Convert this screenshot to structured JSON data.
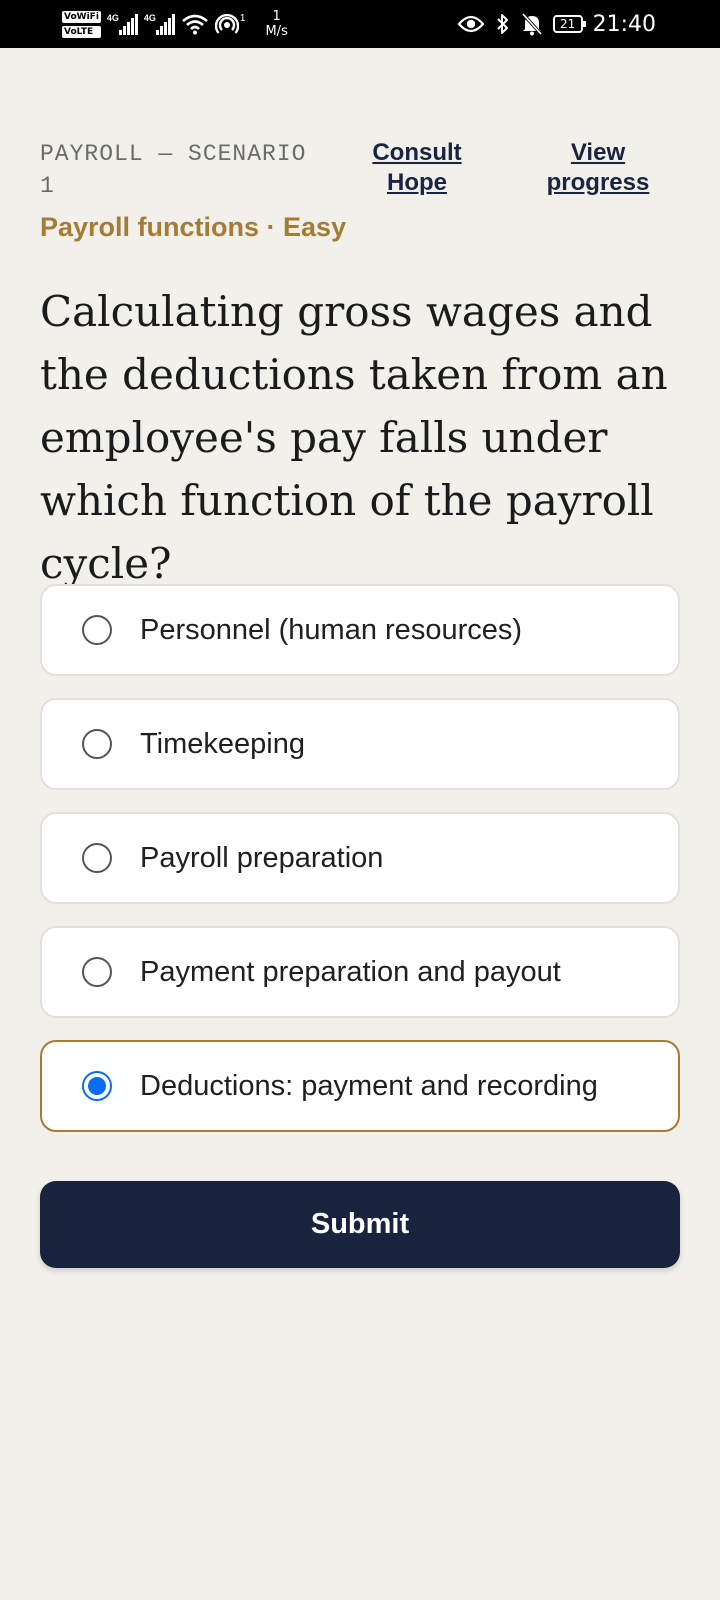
{
  "status_bar": {
    "vowifi": "VoWiFi",
    "volte": "VoLTE",
    "sim1_net": "4G",
    "sim2_net": "4G",
    "hotspot_count": "1",
    "speed_value": "1",
    "speed_unit": "M/s",
    "battery": "21",
    "time": "21:40",
    "icons": [
      "wifi-icon",
      "hotspot-icon",
      "eye-icon",
      "bluetooth-icon",
      "bell-muted-icon",
      "battery-icon"
    ]
  },
  "header": {
    "scenario": "PAYROLL — SCENARIO 1",
    "consult_link": "Consult Hope",
    "progress_link": "View progress"
  },
  "category": "Payroll functions · Easy",
  "question": "Calculating gross wages and the deductions taken from an employee's pay falls under which function of the payroll cycle?",
  "options": [
    {
      "label": "Personnel (human resources)",
      "selected": false
    },
    {
      "label": "Timekeeping",
      "selected": false
    },
    {
      "label": "Payroll preparation",
      "selected": false
    },
    {
      "label": "Payment preparation and payout",
      "selected": false
    },
    {
      "label": "Deductions: payment and recording",
      "selected": true
    }
  ],
  "submit_label": "Submit",
  "colors": {
    "accent": "#a47c35",
    "primary": "#19233d",
    "radio_selected": "#0a6cf0",
    "background": "#f1f0eb"
  }
}
